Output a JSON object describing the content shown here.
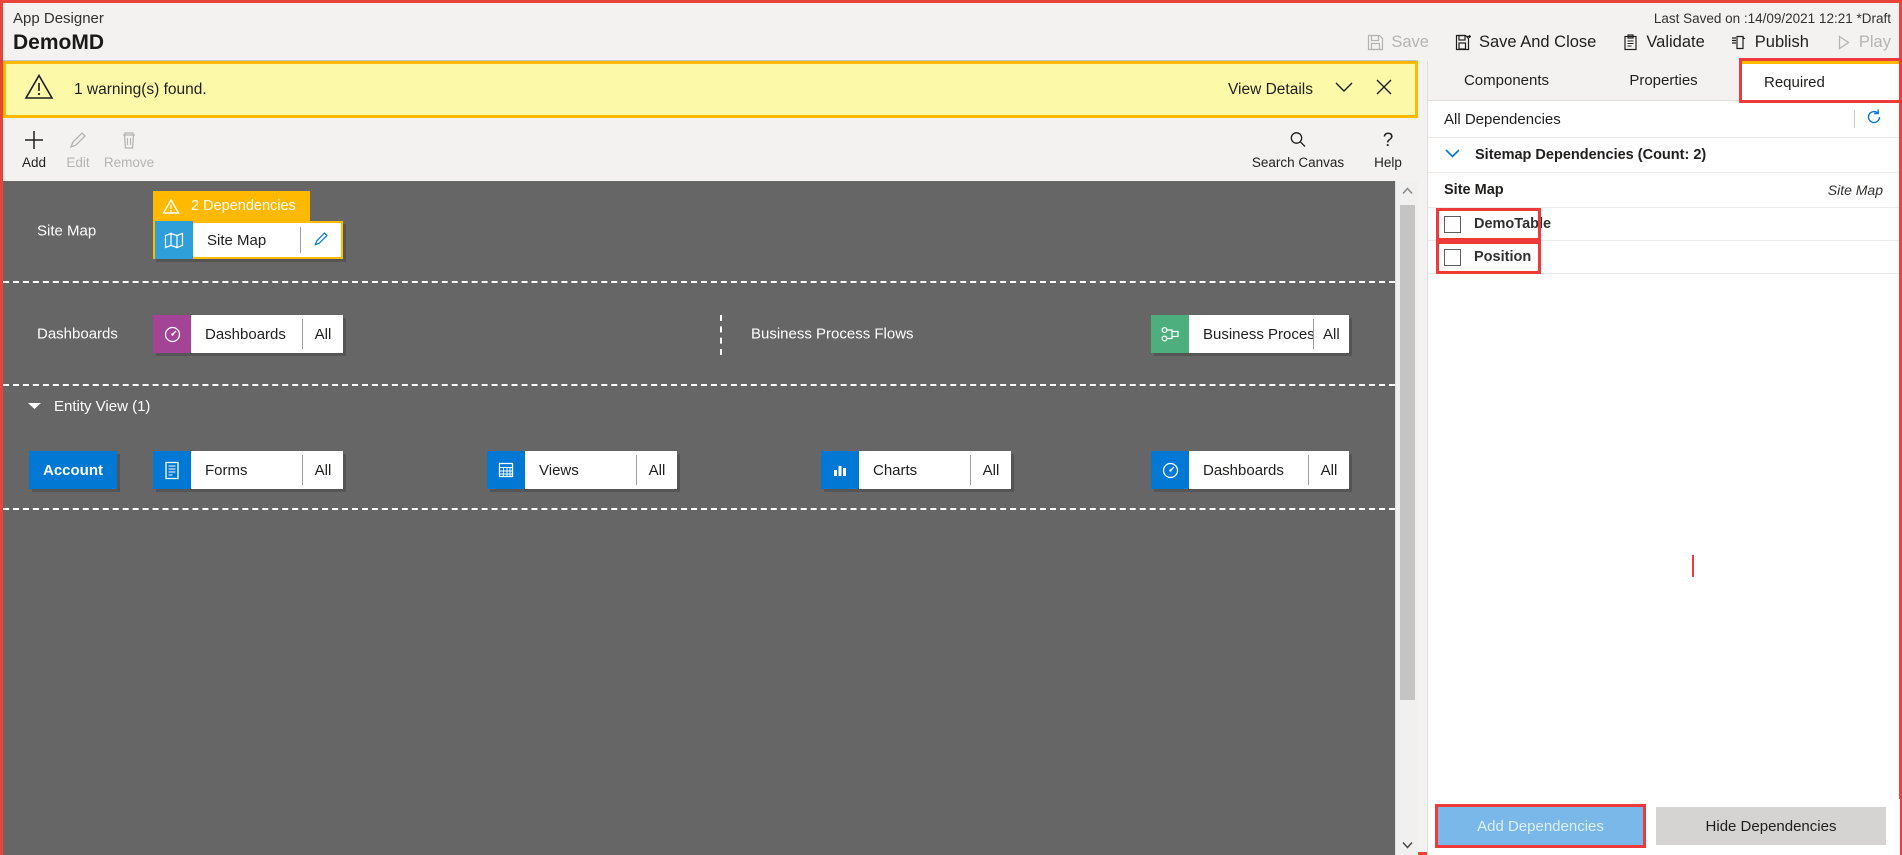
{
  "header": {
    "kicker": "App Designer",
    "title": "DemoMD",
    "last_saved": "Last Saved on :14/09/2021 12:21 *Draft",
    "commands": [
      {
        "label": "Save",
        "icon": "save-icon",
        "disabled": true
      },
      {
        "label": "Save And Close",
        "icon": "save-and-close-icon",
        "disabled": false
      },
      {
        "label": "Validate",
        "icon": "validate-icon",
        "disabled": false
      },
      {
        "label": "Publish",
        "icon": "publish-icon",
        "disabled": false
      },
      {
        "label": "Play",
        "icon": "play-icon",
        "disabled": true
      }
    ]
  },
  "warning": {
    "icon": "warning-triangle-icon",
    "message": "1 warning(s) found.",
    "view_details": "View Details",
    "chevron_icon": "chevron-down-icon",
    "close_icon": "close-icon",
    "background": "#fcfaa8",
    "border": "#ffb900"
  },
  "toolbar": {
    "items": [
      {
        "label": "Add",
        "icon": "plus-icon",
        "disabled": false
      },
      {
        "label": "Edit",
        "icon": "pencil-icon",
        "disabled": true
      },
      {
        "label": "Remove",
        "icon": "trash-icon",
        "disabled": true
      }
    ],
    "right_items": [
      {
        "label": "Search Canvas",
        "icon": "search-icon"
      },
      {
        "label": "Help",
        "icon": "question-mark-icon"
      }
    ]
  },
  "canvas": {
    "sitemap_band": {
      "label": "Site Map",
      "dependency_badge": {
        "text": "2 Dependencies",
        "icon": "warning-triangle-icon",
        "color": "#ffb900"
      },
      "tile": {
        "name": "Site Map",
        "icon": "map-icon",
        "icon_color": "#2e9fd8",
        "edit_icon": "pencil-icon",
        "selected": true
      }
    },
    "dashboards_band": {
      "label": "Dashboards",
      "tile": {
        "name": "Dashboards",
        "count": "All",
        "icon": "dashboard-icon",
        "icon_color": "#a44497"
      },
      "bpf_label": "Business Process Flows",
      "bpf_tile": {
        "name": "Business Proces...",
        "count": "All",
        "icon": "process-flow-icon",
        "icon_color": "#4caf7d"
      }
    },
    "entity_view": {
      "label": "Entity View (1)",
      "expand_icon": "caret-down-icon",
      "entity": "Account",
      "tiles": [
        {
          "name": "Forms",
          "count": "All",
          "icon": "forms-icon",
          "icon_color": "#0078d4"
        },
        {
          "name": "Views",
          "count": "All",
          "icon": "views-grid-icon",
          "icon_color": "#0078d4"
        },
        {
          "name": "Charts",
          "count": "All",
          "icon": "bar-chart-icon",
          "icon_color": "#0078d4"
        },
        {
          "name": "Dashboards",
          "count": "All",
          "icon": "dashboard-icon",
          "icon_color": "#0078d4"
        }
      ]
    }
  },
  "right_panel": {
    "tabs": [
      {
        "label": "Components",
        "active": false,
        "highlighted": false
      },
      {
        "label": "Properties",
        "active": false,
        "highlighted": false
      },
      {
        "label": "Required",
        "active": true,
        "highlighted": true
      }
    ],
    "all_dependencies_label": "All Dependencies",
    "refresh_icon": "refresh-icon",
    "group": {
      "label": "Sitemap Dependencies (Count: 2)",
      "collapse_icon": "chevron-down-icon"
    },
    "section_row": {
      "left": "Site Map",
      "right": "Site Map"
    },
    "items": [
      {
        "label": "DemoTable",
        "checked": false,
        "highlighted": true
      },
      {
        "label": "Position",
        "checked": false,
        "highlighted": true
      }
    ],
    "footer": {
      "add_label": "Add Dependencies",
      "add_disabled": true,
      "add_highlighted": true,
      "hide_label": "Hide Dependencies"
    }
  },
  "colors": {
    "canvas_bg": "#666666",
    "accent_blue": "#0078d4",
    "warning_yellow": "#ffb900",
    "highlight_red": "#ed3b3b",
    "chrome_gray": "#f3f2f1"
  }
}
